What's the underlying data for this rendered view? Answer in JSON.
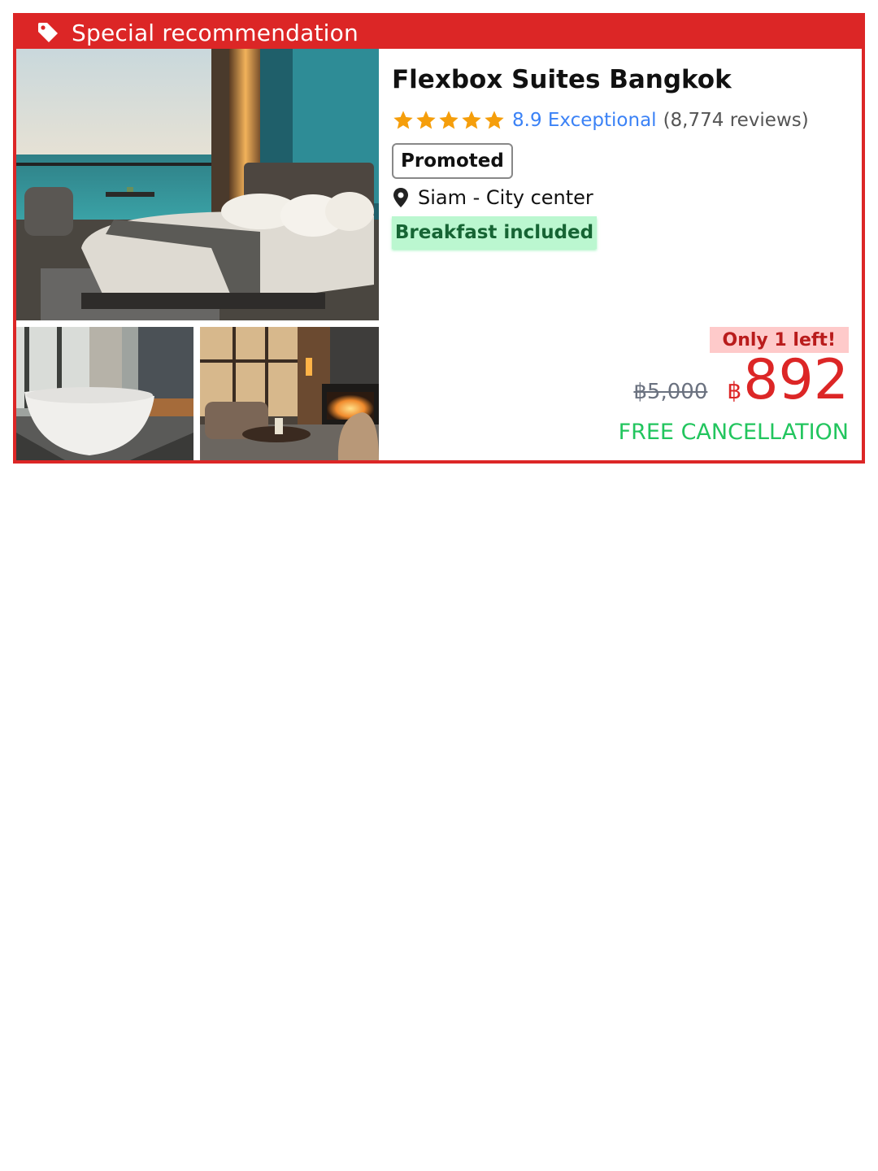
{
  "banner": {
    "icon": "tag-icon",
    "label": "Special recommendation",
    "color": "#dc2626"
  },
  "gallery": {
    "photos": [
      {
        "name": "photo-bedroom-ocean-view"
      },
      {
        "name": "photo-bathtub"
      },
      {
        "name": "photo-lounge-fireplace"
      }
    ]
  },
  "hotel": {
    "name": "Flexbox Suites Bangkok",
    "stars": 5,
    "score": "8.9 Exceptional",
    "reviews": "(8,774 reviews)",
    "badge": "Promoted",
    "location_icon": "map-pin-icon",
    "location": "Siam - City center",
    "perk": "Breakfast included"
  },
  "pricing": {
    "scarcity": "Only 1 left!",
    "old_price": "฿5,000",
    "currency": "฿",
    "price": "892",
    "cancellation": "FREE CANCELLATION"
  },
  "colors": {
    "accent": "#dc2626",
    "link": "#3b82f6",
    "star": "#f59e0b",
    "success": "#22c55e",
    "perk_bg": "#bbf7d0"
  }
}
